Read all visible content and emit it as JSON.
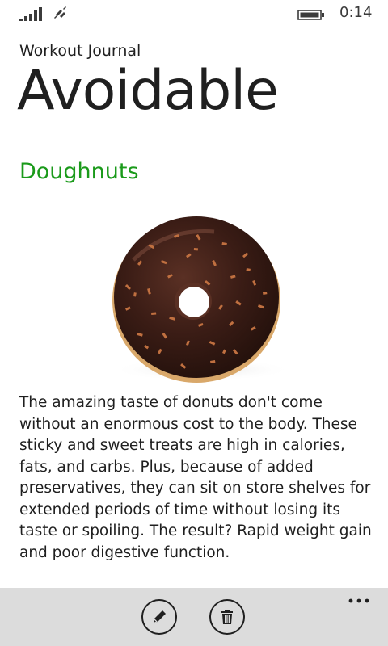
{
  "status_bar": {
    "time": "0:14",
    "icons": [
      "signal-icon",
      "wifi-icon",
      "battery-icon"
    ]
  },
  "header": {
    "app_title": "Workout Journal",
    "page_title": "Avoidable"
  },
  "item": {
    "title": "Doughnuts",
    "title_color": "#1a9a1a",
    "image": "donut-image",
    "description": "The amazing taste of donuts don't come without an enormous cost to the body. These sticky and sweet treats are high in calories, fats, and carbs. Plus, because of added preservatives, they can sit on store shelves for extended periods of time without losing its taste or spoiling. The result? Rapid weight gain and poor digestive function."
  },
  "app_bar": {
    "background": "#dcdcdc",
    "buttons": [
      "pencil-icon",
      "trash-icon"
    ],
    "more": "more-icon"
  }
}
